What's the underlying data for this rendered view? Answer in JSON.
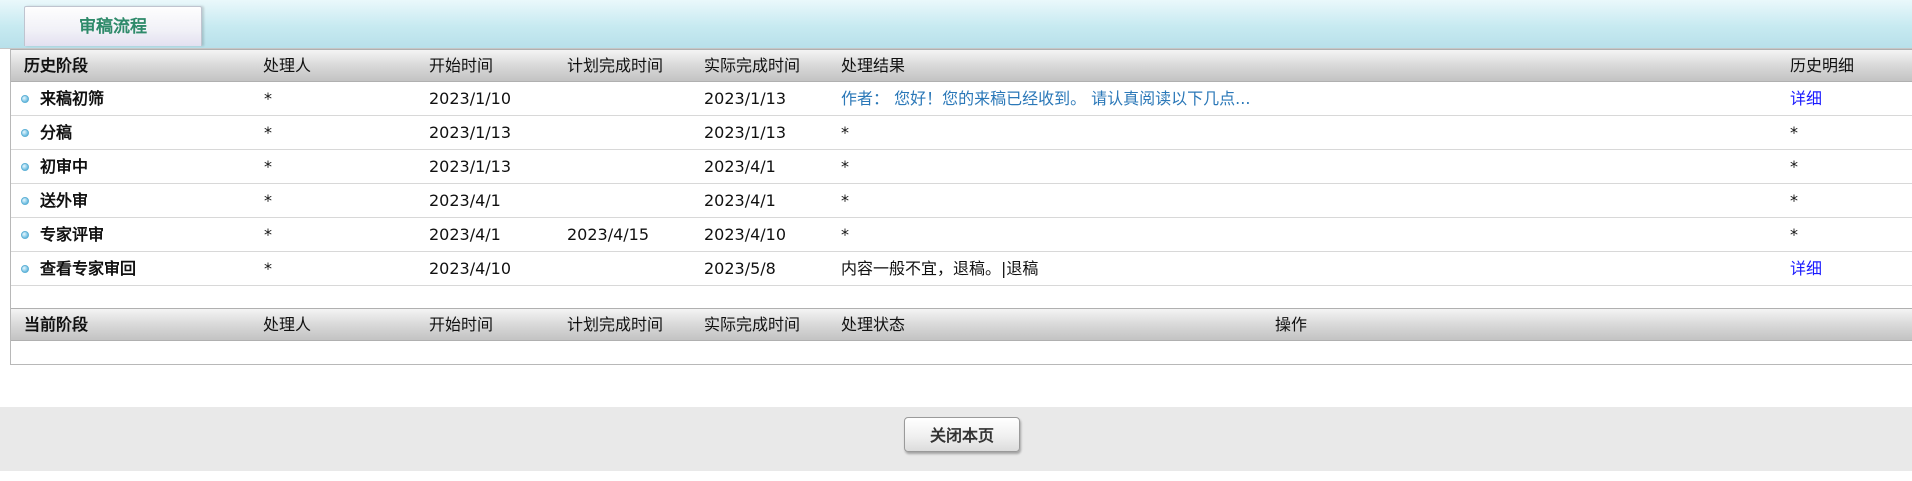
{
  "tab": {
    "label": "审稿流程"
  },
  "history": {
    "headers": {
      "stage": "历史阶段",
      "handler": "处理人",
      "start": "开始时间",
      "planned": "计划完成时间",
      "actual": "实际完成时间",
      "result": "处理结果",
      "detail": "历史明细"
    },
    "rows": [
      {
        "stage": "来稿初筛",
        "handler": "*",
        "start": "2023/1/10",
        "planned": "",
        "actual": "2023/1/13",
        "result": "作者： 您好！您的来稿已经收到。 请认真阅读以下几点...",
        "detail": "详细"
      },
      {
        "stage": "分稿",
        "handler": "*",
        "start": "2023/1/13",
        "planned": "",
        "actual": "2023/1/13",
        "result": "*",
        "detail": "*"
      },
      {
        "stage": "初审中",
        "handler": "*",
        "start": "2023/1/13",
        "planned": "",
        "actual": "2023/4/1",
        "result": "*",
        "detail": "*"
      },
      {
        "stage": "送外审",
        "handler": "*",
        "start": "2023/4/1",
        "planned": "",
        "actual": "2023/4/1",
        "result": "*",
        "detail": "*"
      },
      {
        "stage": "专家评审",
        "handler": "*",
        "start": "2023/4/1",
        "planned": "2023/4/15",
        "actual": "2023/4/10",
        "result": "*",
        "detail": "*"
      },
      {
        "stage": "查看专家审回",
        "handler": "*",
        "start": "2023/4/10",
        "planned": "",
        "actual": "2023/5/8",
        "result": "内容一般不宜，退稿。|退稿",
        "detail": "详细"
      }
    ]
  },
  "current": {
    "headers": {
      "stage": "当前阶段",
      "handler": "处理人",
      "start": "开始时间",
      "planned": "计划完成时间",
      "actual": "实际完成时间",
      "status": "处理状态",
      "action": "操作"
    }
  },
  "footer": {
    "close_label": "关闭本页"
  },
  "colors": {
    "tab_text": "#2e8a6a",
    "result_link": "#2b78b8",
    "detail_link": "#1a1aff",
    "tab_bar": "#c7eaf1"
  }
}
